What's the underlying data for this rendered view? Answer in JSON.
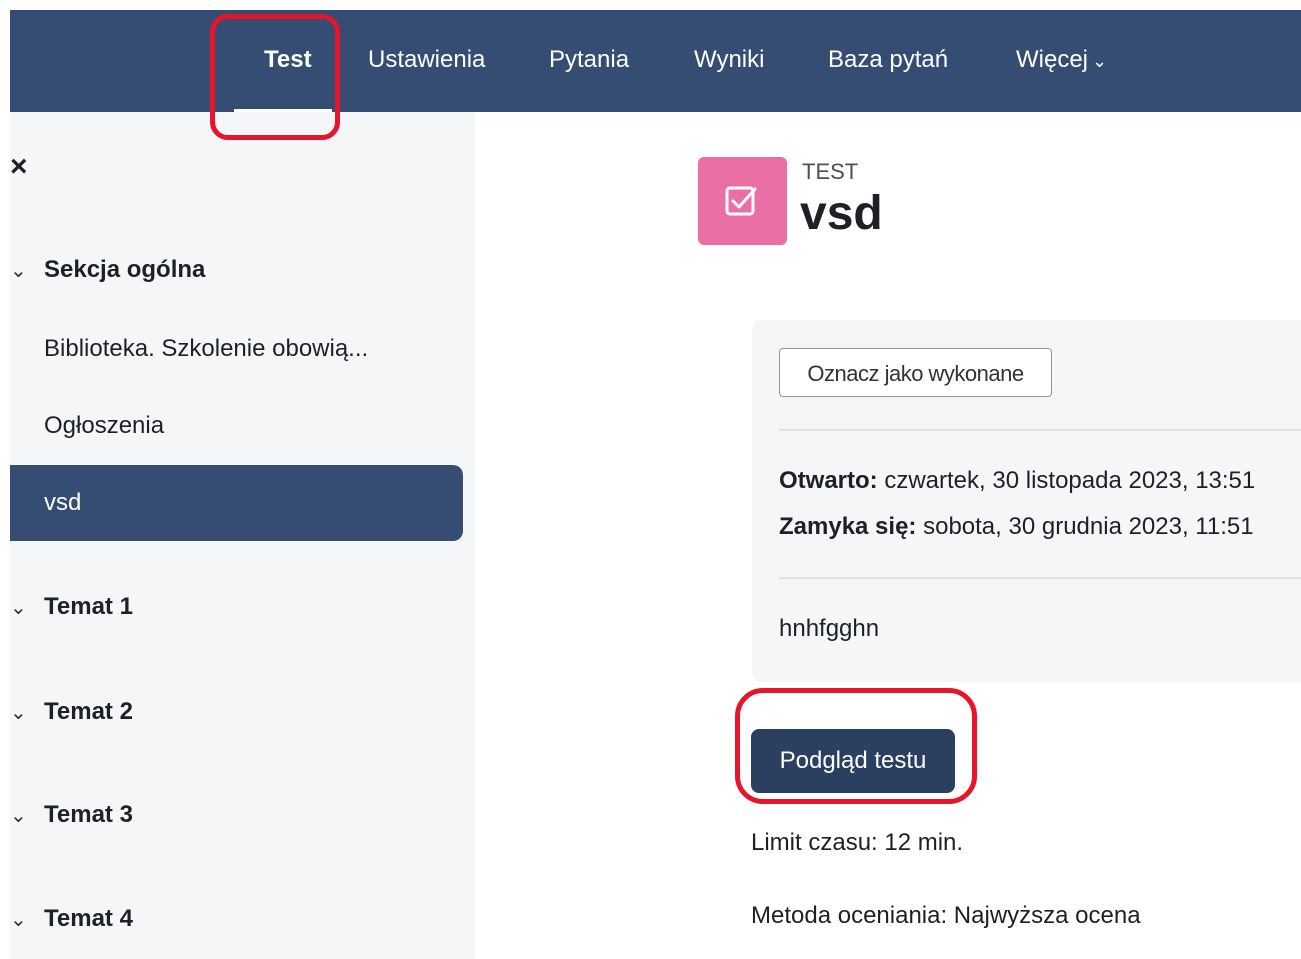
{
  "nav": {
    "tabs": [
      {
        "label": "Test",
        "active": true
      },
      {
        "label": "Ustawienia"
      },
      {
        "label": "Pytania"
      },
      {
        "label": "Wyniki"
      },
      {
        "label": "Baza pytań"
      },
      {
        "label": "Więcej"
      }
    ],
    "more_icon": "chevron-down-icon"
  },
  "sidebar": {
    "close_icon": "close-icon",
    "sections": [
      {
        "label": "Sekcja ogólna",
        "expanded": true
      },
      {
        "label": "Temat 1"
      },
      {
        "label": "Temat 2"
      },
      {
        "label": "Temat 3"
      },
      {
        "label": "Temat 4"
      }
    ],
    "items": [
      {
        "label": "Biblioteka. Szkolenie obowią..."
      },
      {
        "label": "Ogłoszenia"
      },
      {
        "label": "vsd",
        "active": true
      }
    ]
  },
  "activity": {
    "type": "TEST",
    "title": "vsd",
    "icon": "quiz-checkbox-icon",
    "icon_color": "#ea6fa6"
  },
  "completion": {
    "button_label": "Oznacz jako wykonane"
  },
  "dates": {
    "opened_label": "Otwarto:",
    "opened_value": "czwartek, 30 listopada 2023, 13:51",
    "closes_label": "Zamyka się:",
    "closes_value": "sobota, 30 grudnia 2023, 11:51"
  },
  "description": "hnhfgghn",
  "preview_button": "Podgląd testu",
  "info": {
    "time_limit": "Limit czasu: 12 min.",
    "grading_method": "Metoda oceniania: Najwyższa ocena"
  },
  "colors": {
    "nav_bg": "#354d73",
    "button_dark": "#2b3f60",
    "highlight": "#e8142c"
  }
}
